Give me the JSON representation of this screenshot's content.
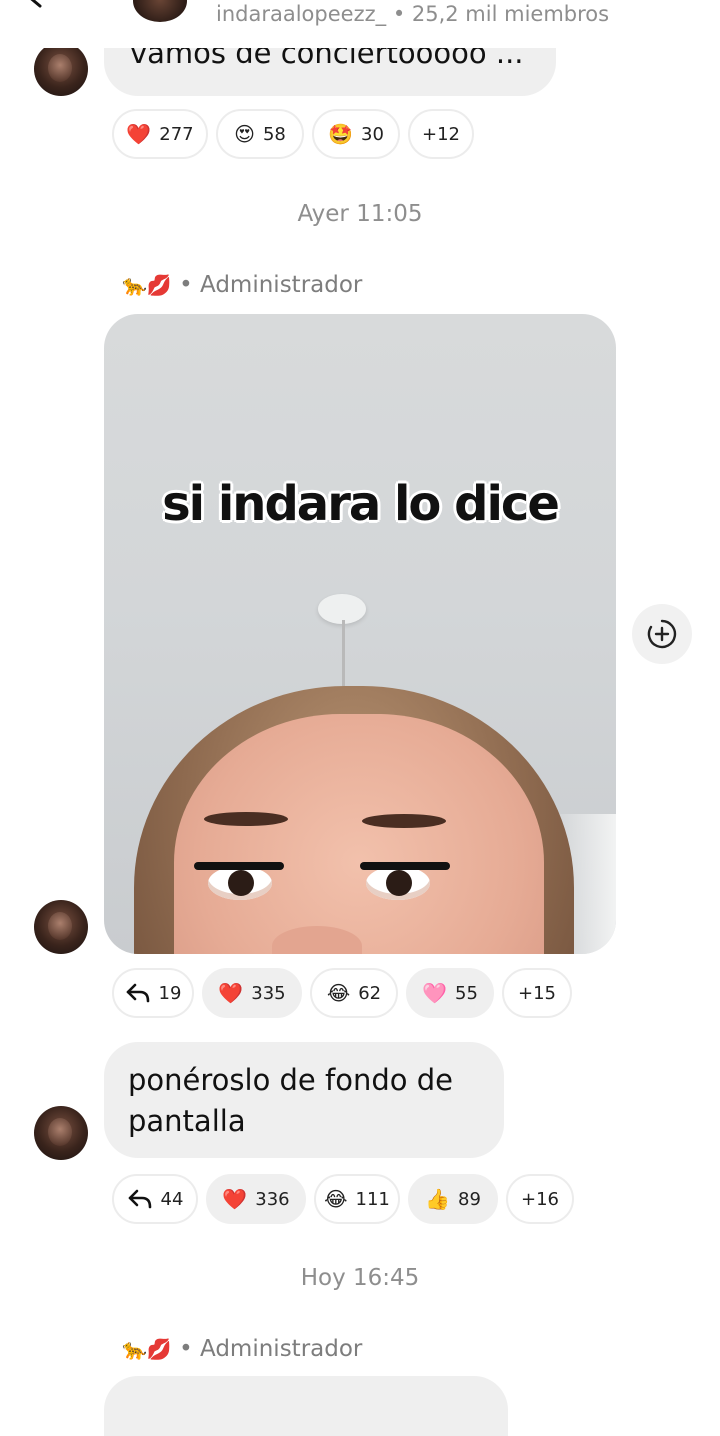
{
  "header": {
    "group_name": "indaraalopeezz_",
    "members": "• 25,2 mil miembros"
  },
  "messages": [
    {
      "text": "vamos de conciertooooo ...",
      "reactions": [
        {
          "emoji": "❤️",
          "count": "277"
        },
        {
          "emoji": "😍",
          "count": "58"
        },
        {
          "emoji": "🤩",
          "count": "30"
        },
        {
          "emoji": "",
          "count": "+12"
        }
      ]
    },
    {
      "timestamp": "Ayer 11:05",
      "sender_emoji": "🐆💋",
      "sender_role": "• Administrador",
      "media_caption": "si indara lo dice",
      "replies": "19",
      "reactions": [
        {
          "emoji": "❤️",
          "count": "335"
        },
        {
          "emoji": "😂",
          "count": "62"
        },
        {
          "emoji": "🩷",
          "count": "55"
        },
        {
          "emoji": "",
          "count": "+15"
        }
      ]
    },
    {
      "text": "ponéroslo de fondo de pantalla",
      "replies": "44",
      "reactions": [
        {
          "emoji": "❤️",
          "count": "336"
        },
        {
          "emoji": "😂",
          "count": "111"
        },
        {
          "emoji": "👍",
          "count": "89"
        },
        {
          "emoji": "",
          "count": "+16"
        }
      ]
    },
    {
      "timestamp": "Hoy 16:45",
      "sender_emoji": "🐆💋",
      "sender_role": "• Administrador"
    }
  ],
  "icons": {
    "back": "back-arrow-icon",
    "bell": "bell-icon",
    "reply": "reply-arrow-icon",
    "add_sticker": "add-sticker-icon"
  }
}
